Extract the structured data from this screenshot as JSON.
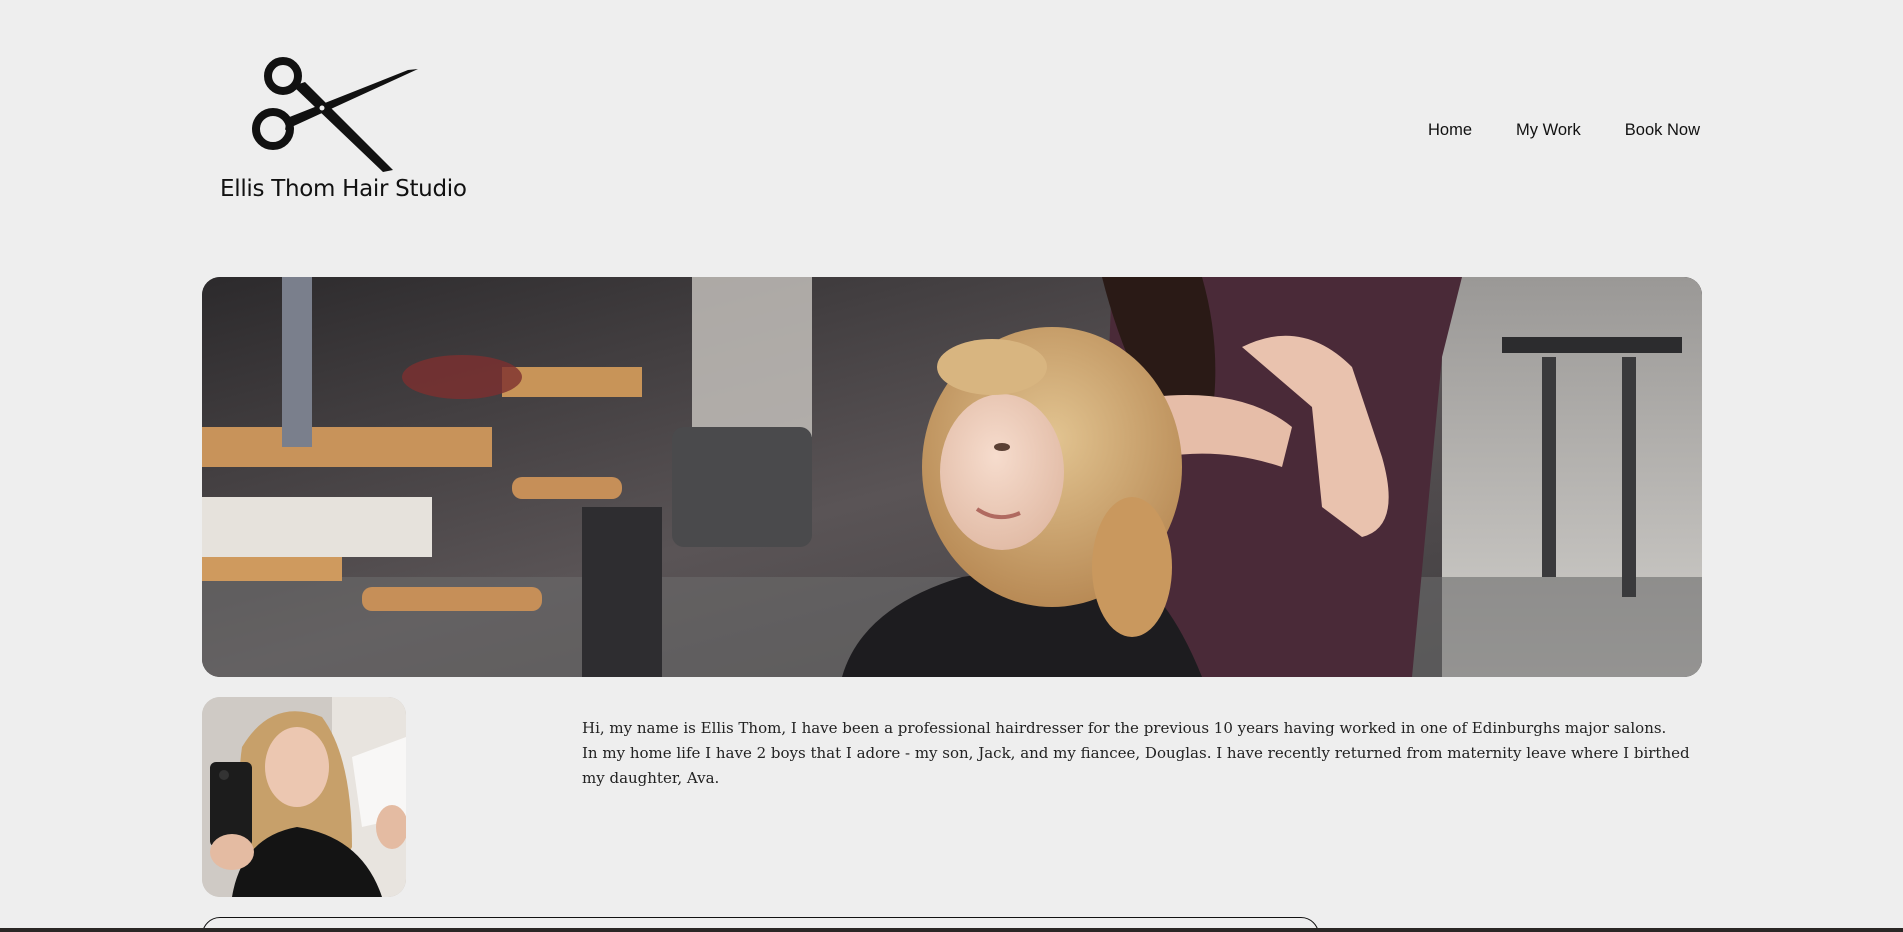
{
  "brand": {
    "name": "Ellis Thom Hair Studio",
    "logo_icon": "scissors-icon"
  },
  "nav": {
    "items": [
      {
        "label": "Home"
      },
      {
        "label": "My Work"
      },
      {
        "label": "Book Now"
      }
    ]
  },
  "hero": {
    "image": "salon-photo"
  },
  "about": {
    "avatar": "profile-photo",
    "paragraphs": [
      "Hi, my name is Ellis Thom, I have been a professional hairdresser for the previous 10 years having worked in one of Edinburghs major salons.",
      "In my home life I have 2 boys that I adore - my son, Jack, and my fiancee, Douglas. I have recently returned from maternity leave where I birthed my daughter, Ava."
    ]
  },
  "colors": {
    "background": "#eeeeee",
    "text": "#111111"
  }
}
